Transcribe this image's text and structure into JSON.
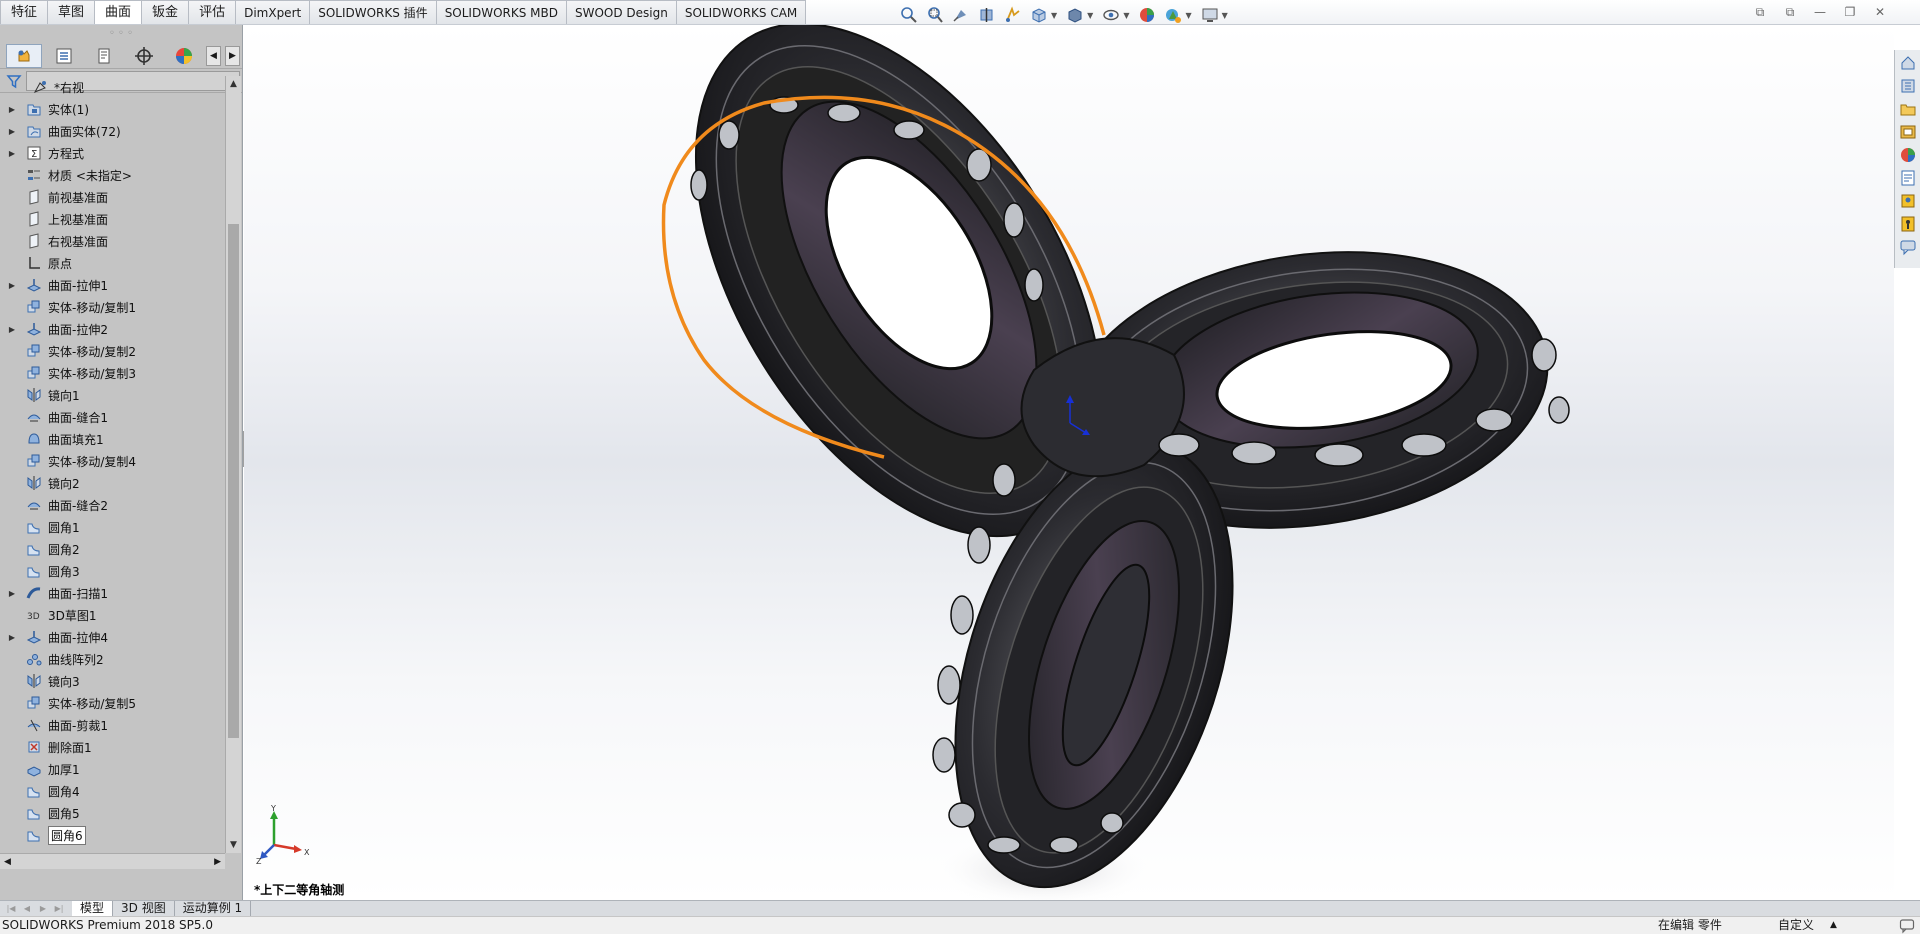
{
  "tabs": [
    {
      "label": "特征",
      "active": false
    },
    {
      "label": "草图",
      "active": false
    },
    {
      "label": "曲面",
      "active": true
    },
    {
      "label": "钣金",
      "active": false
    },
    {
      "label": "评估",
      "active": false
    },
    {
      "label": "DimXpert",
      "active": false
    },
    {
      "label": "SOLIDWORKS 插件",
      "active": false
    },
    {
      "label": "SOLIDWORKS MBD",
      "active": false
    },
    {
      "label": "SWOOD Design",
      "active": false
    },
    {
      "label": "SOLIDWORKS CAM",
      "active": false
    }
  ],
  "tree": {
    "header": "*右视",
    "items": [
      {
        "label": "实体(1)",
        "icon": "solid-bodies-folder-icon",
        "expandable": true
      },
      {
        "label": "曲面实体(72)",
        "icon": "surface-bodies-folder-icon",
        "expandable": true
      },
      {
        "label": "方程式",
        "icon": "equations-icon",
        "expandable": true
      },
      {
        "label": "材质 <未指定>",
        "icon": "material-icon",
        "expandable": false
      },
      {
        "label": "前视基准面",
        "icon": "plane-icon",
        "expandable": false
      },
      {
        "label": "上视基准面",
        "icon": "plane-icon",
        "expandable": false
      },
      {
        "label": "右视基准面",
        "icon": "plane-icon",
        "expandable": false
      },
      {
        "label": "原点",
        "icon": "origin-icon",
        "expandable": false
      },
      {
        "label": "曲面-拉伸1",
        "icon": "surface-extrude-icon",
        "expandable": true
      },
      {
        "label": "实体-移动/复制1",
        "icon": "move-copy-icon",
        "expandable": false
      },
      {
        "label": "曲面-拉伸2",
        "icon": "surface-extrude-icon",
        "expandable": true
      },
      {
        "label": "实体-移动/复制2",
        "icon": "move-copy-icon",
        "expandable": false
      },
      {
        "label": "实体-移动/复制3",
        "icon": "move-copy-icon",
        "expandable": false
      },
      {
        "label": "镜向1",
        "icon": "mirror-icon",
        "expandable": false
      },
      {
        "label": "曲面-缝合1",
        "icon": "knit-icon",
        "expandable": false
      },
      {
        "label": "曲面填充1",
        "icon": "fill-icon",
        "expandable": false
      },
      {
        "label": "实体-移动/复制4",
        "icon": "move-copy-icon",
        "expandable": false
      },
      {
        "label": "镜向2",
        "icon": "mirror-icon",
        "expandable": false
      },
      {
        "label": "曲面-缝合2",
        "icon": "knit-icon",
        "expandable": false
      },
      {
        "label": "圆角1",
        "icon": "fillet-icon",
        "expandable": false
      },
      {
        "label": "圆角2",
        "icon": "fillet-icon",
        "expandable": false
      },
      {
        "label": "圆角3",
        "icon": "fillet-icon",
        "expandable": false
      },
      {
        "label": "曲面-扫描1",
        "icon": "sweep-icon",
        "expandable": true
      },
      {
        "label": "3D草图1",
        "icon": "3d-sketch-icon",
        "expandable": false
      },
      {
        "label": "曲面-拉伸4",
        "icon": "surface-extrude-icon",
        "expandable": true
      },
      {
        "label": "曲线阵列2",
        "icon": "curve-pattern-icon",
        "expandable": false
      },
      {
        "label": "镜向3",
        "icon": "mirror-icon",
        "expandable": false
      },
      {
        "label": "实体-移动/复制5",
        "icon": "move-copy-icon",
        "expandable": false
      },
      {
        "label": "曲面-剪裁1",
        "icon": "trim-icon",
        "expandable": false
      },
      {
        "label": "删除面1",
        "icon": "delete-face-icon",
        "expandable": false
      },
      {
        "label": "加厚1",
        "icon": "thicken-icon",
        "expandable": false
      },
      {
        "label": "圆角4",
        "icon": "fillet-icon",
        "expandable": false
      },
      {
        "label": "圆角5",
        "icon": "fillet-icon",
        "expandable": false
      },
      {
        "label": "圆角6",
        "icon": "fillet-icon",
        "expandable": false,
        "selected": true
      }
    ]
  },
  "viewport": {
    "view_label": "*上下二等角轴测",
    "triad": {
      "x": "X",
      "y": "Y",
      "z": "Z"
    }
  },
  "bottom_tabs": [
    {
      "label": "模型",
      "active": true
    },
    {
      "label": "3D 视图",
      "active": false
    },
    {
      "label": "运动算例 1",
      "active": false
    }
  ],
  "status": {
    "app": "SOLIDWORKS Premium 2018 SP5.0",
    "mode": "在编辑 零件",
    "units": "自定义"
  },
  "colors": {
    "accent_edge": "#f08a1c",
    "model_body": "#2a2a2e",
    "panel_bg": "#c4c4c4"
  }
}
